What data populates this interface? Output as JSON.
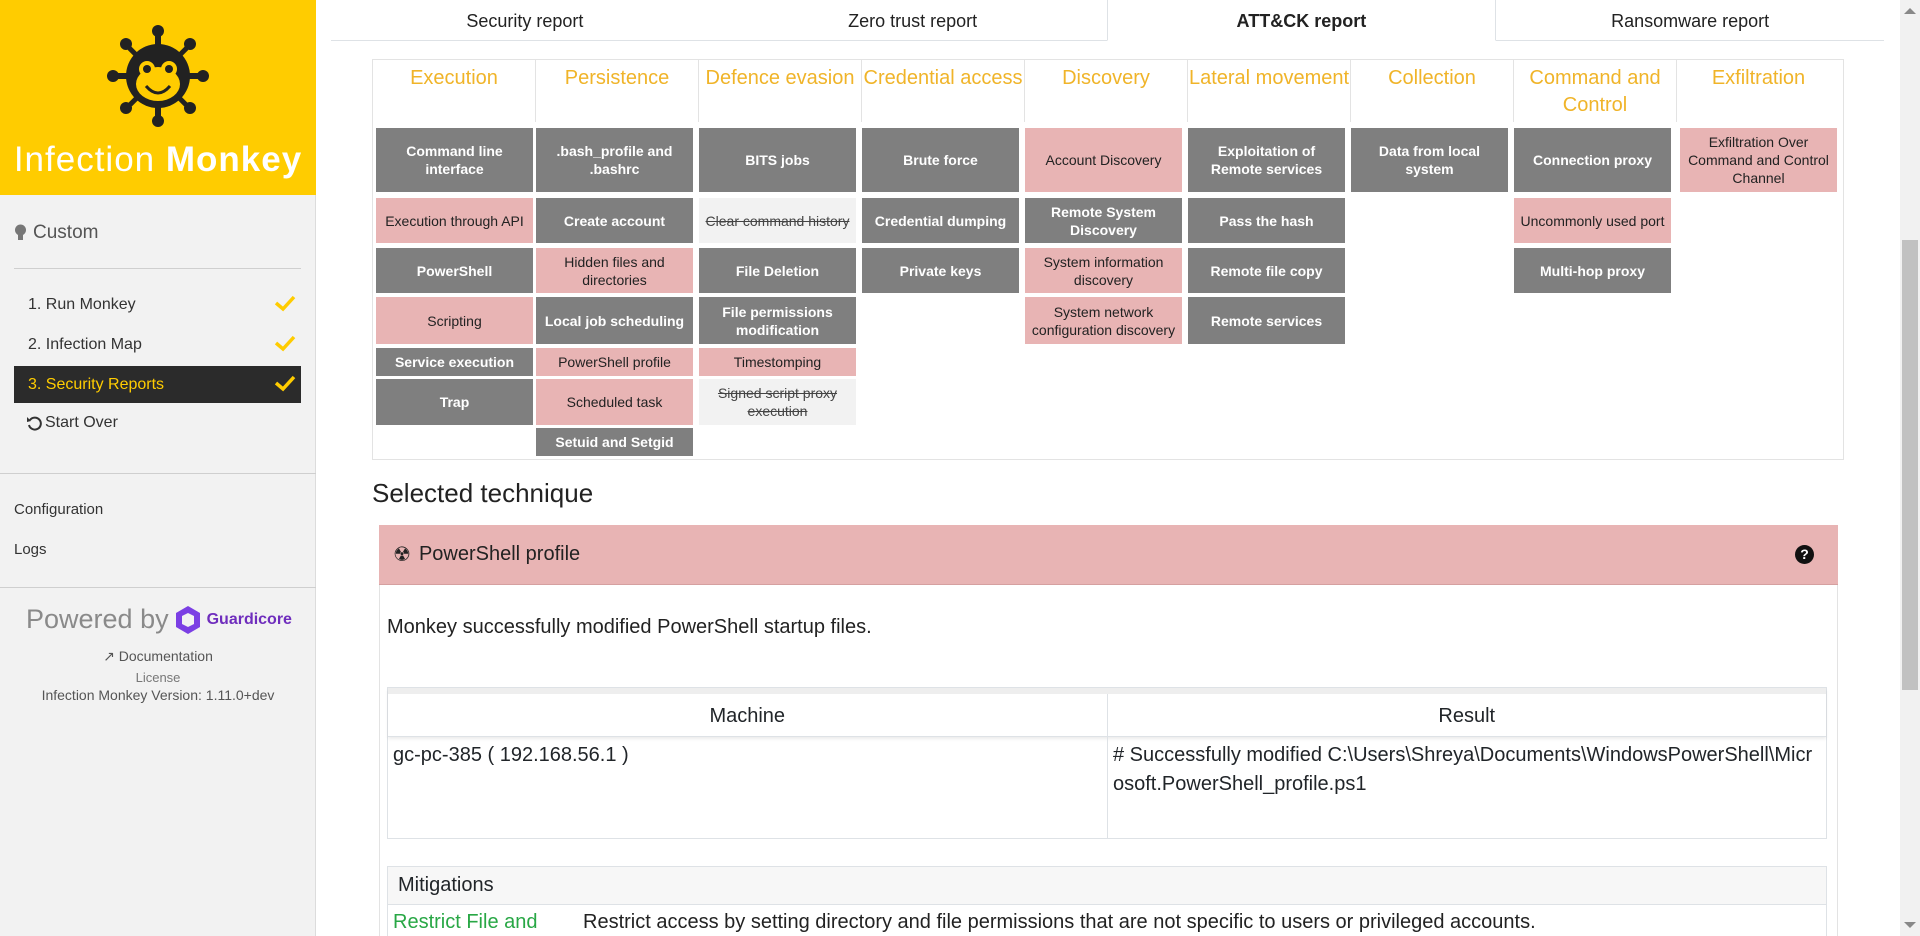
{
  "sidebar": {
    "logo_text_light": "Infection ",
    "logo_text_bold": "Monkey",
    "mode_label": "Custom",
    "nav": [
      {
        "label": "1. Run Monkey"
      },
      {
        "label": "2. Infection Map"
      },
      {
        "label": "3. Security Reports"
      }
    ],
    "start_over": "Start Over",
    "configuration": "Configuration",
    "logs": "Logs",
    "powered_by": "Powered by",
    "guardicore": "Guardicore",
    "documentation": "Documentation",
    "license": "License",
    "version": "Infection Monkey Version: 1.11.0+dev"
  },
  "tabs": [
    "Security report",
    "Zero trust report",
    "ATT&CK report",
    "Ransomware report"
  ],
  "matrix": {
    "columns": [
      "Execution",
      "Persistence",
      "Defence evasion",
      "Credential access",
      "Discovery",
      "Lateral movement",
      "Collection",
      "Command and Control",
      "Exfiltration"
    ],
    "cells": {
      "execution": [
        "Command line interface",
        "Execution through API",
        "PowerShell",
        "Scripting",
        "Service execution",
        "Trap"
      ],
      "persistence": [
        ".bash_profile and .bashrc",
        "Create account",
        "Hidden files and directories",
        "Local job scheduling",
        "PowerShell profile",
        "Scheduled task",
        "Setuid and Setgid"
      ],
      "defence": [
        "BITS jobs",
        "Clear command history",
        "File Deletion",
        "File permissions modification",
        "Timestomping",
        "Signed script proxy execution"
      ],
      "credential": [
        "Brute force",
        "Credential dumping",
        "Private keys"
      ],
      "discovery": [
        "Account Discovery",
        "Remote System Discovery",
        "System information discovery",
        "System network configuration discovery"
      ],
      "lateral": [
        "Exploitation of Remote services",
        "Pass the hash",
        "Remote file copy",
        "Remote services"
      ],
      "collection": [
        "Data from local system"
      ],
      "c2": [
        "Connection proxy",
        "Uncommonly used port",
        "Multi-hop proxy"
      ],
      "exfil": [
        "Exfiltration Over Command and Control Channel"
      ]
    }
  },
  "selected": {
    "heading": "Selected technique",
    "technique": "PowerShell profile",
    "help": "?",
    "message": "Monkey successfully modified PowerShell startup files.",
    "table": {
      "col_machine": "Machine",
      "col_result": "Result",
      "machine": "gc-pc-385 ( 192.168.56.1 )",
      "result": "# Successfully modified C:\\Users\\Shreya\\Documents\\WindowsPowerShell\\Microsoft.PowerShell_profile.ps1"
    },
    "mitigations": {
      "heading": "Mitigations",
      "name": "Restrict File and",
      "desc": "Restrict access by setting directory and file permissions that are not specific to users or privileged accounts."
    }
  },
  "colors": {
    "brand_yellow": "#ffcc00",
    "header_gold": "#f0b429",
    "used_grey": "#7f7f7f",
    "attempted_pink": "#e8b4b4",
    "link_green": "#28a745"
  }
}
